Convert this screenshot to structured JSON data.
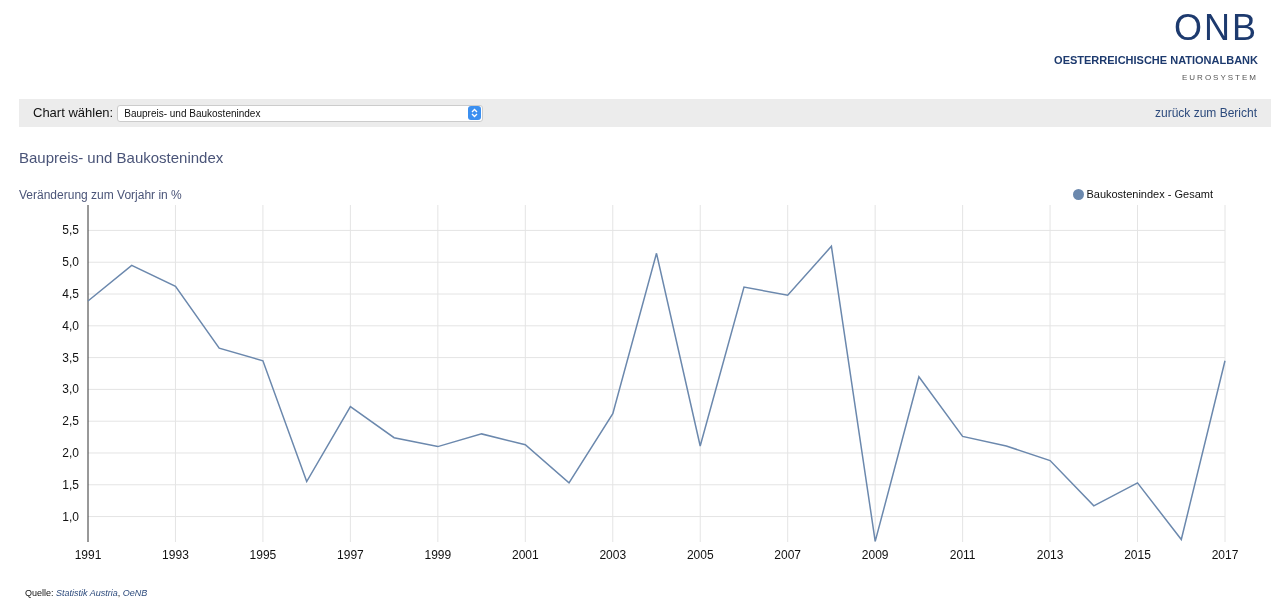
{
  "logo": {
    "mark": "ONB",
    "name": "OESTERREICHISCHE NATIONALBANK",
    "sub": "EUROSYSTEM"
  },
  "toolbar": {
    "label": "Chart wählen:",
    "select_value": "Baupreis- und Baukostenindex",
    "back_link": "zurück zum Bericht"
  },
  "title": "Baupreis- und Baukostenindex",
  "chart": {
    "chart_data": {
      "type": "line",
      "ylabel": "Veränderung zum Vorjahr in %",
      "grid": true,
      "xlim": [
        1991,
        2017
      ],
      "x": [
        1991,
        1992,
        1993,
        1994,
        1995,
        1996,
        1997,
        1998,
        1999,
        2000,
        2001,
        2002,
        2003,
        2004,
        2005,
        2006,
        2007,
        2008,
        2009,
        2010,
        2011,
        2012,
        2013,
        2014,
        2015,
        2016,
        2017
      ],
      "series": [
        {
          "name": "Baukostenindex - Gesamt",
          "color": "#6b88ad",
          "values": [
            4.39,
            4.95,
            4.62,
            3.65,
            3.45,
            1.55,
            2.73,
            2.24,
            2.1,
            2.3,
            2.13,
            1.53,
            2.62,
            5.14,
            2.11,
            4.61,
            4.48,
            5.25,
            0.61,
            3.2,
            2.26,
            2.11,
            1.88,
            1.17,
            1.53,
            0.64,
            3.45
          ]
        }
      ],
      "ylim": [
        0.6,
        5.9
      ],
      "yticks": [
        {
          "value": 1,
          "label": "1,0"
        },
        {
          "value": 1.5,
          "label": "1,5"
        },
        {
          "value": 2,
          "label": "2,0"
        },
        {
          "value": 2.5,
          "label": "2,5"
        },
        {
          "value": 3,
          "label": "3,0"
        },
        {
          "value": 3.5,
          "label": "3,5"
        },
        {
          "value": 4,
          "label": "4,0"
        },
        {
          "value": 4.5,
          "label": "4,5"
        },
        {
          "value": 5,
          "label": "5,0"
        },
        {
          "value": 5.5,
          "label": "5,5"
        }
      ],
      "xticks": [
        1991,
        1993,
        1995,
        1997,
        1999,
        2001,
        2003,
        2005,
        2007,
        2009,
        2011,
        2013,
        2015,
        2017
      ]
    }
  },
  "source": {
    "label": "Quelle:",
    "separator": ",",
    "links": [
      "Statistik Austria",
      "OeNB"
    ]
  }
}
